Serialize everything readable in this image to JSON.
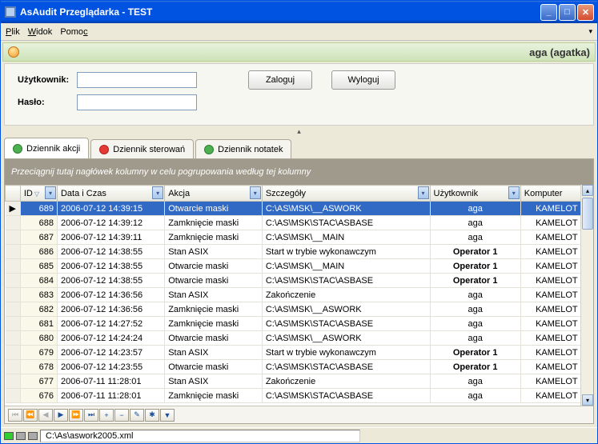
{
  "window": {
    "title": "AsAudit Przeglądarka - TEST"
  },
  "menu": {
    "plik": "Plik",
    "widok": "Widok",
    "pomoc": "Pomoc"
  },
  "userbar": {
    "text": "aga (agatka)"
  },
  "login": {
    "user_label": "Użytkownik:",
    "pass_label": "Hasło:",
    "user_value": "",
    "pass_value": "",
    "login_btn": "Zaloguj",
    "logout_btn": "Wyloguj"
  },
  "tabs": {
    "t0": "Dziennik akcji",
    "t1": "Dziennik sterowań",
    "t2": "Dziennik notatek"
  },
  "group_panel": "Przeciągnij tutaj nagłówek kolumny w celu pogrupowania według tej kolumny",
  "cols": {
    "id": "ID",
    "data": "Data i Czas",
    "akcja": "Akcja",
    "szcz": "Szczegóły",
    "user": "Użytkownik",
    "komp": "Komputer"
  },
  "rows": [
    {
      "id": "689",
      "dt": "2006-07-12 14:39:15",
      "ak": "Otwarcie maski",
      "sz": "C:\\AS\\MSK\\__ASWORK",
      "us": "aga",
      "ko": "KAMELOT",
      "sel": true
    },
    {
      "id": "688",
      "dt": "2006-07-12 14:39:12",
      "ak": "Zamknięcie maski",
      "sz": "C:\\AS\\MSK\\STAC\\ASBASE",
      "us": "aga",
      "ko": "KAMELOT"
    },
    {
      "id": "687",
      "dt": "2006-07-12 14:39:11",
      "ak": "Zamknięcie maski",
      "sz": "C:\\AS\\MSK\\__MAIN",
      "us": "aga",
      "ko": "KAMELOT"
    },
    {
      "id": "686",
      "dt": "2006-07-12 14:38:55",
      "ak": "Stan ASIX",
      "sz": "Start w trybie wykonawczym",
      "us": "Operator 1",
      "ko": "KAMELOT",
      "b": true
    },
    {
      "id": "685",
      "dt": "2006-07-12 14:38:55",
      "ak": "Otwarcie maski",
      "sz": "C:\\AS\\MSK\\__MAIN",
      "us": "Operator 1",
      "ko": "KAMELOT",
      "b": true
    },
    {
      "id": "684",
      "dt": "2006-07-12 14:38:55",
      "ak": "Otwarcie maski",
      "sz": "C:\\AS\\MSK\\STAC\\ASBASE",
      "us": "Operator 1",
      "ko": "KAMELOT",
      "b": true
    },
    {
      "id": "683",
      "dt": "2006-07-12 14:36:56",
      "ak": "Stan ASIX",
      "sz": "Zakończenie",
      "us": "aga",
      "ko": "KAMELOT"
    },
    {
      "id": "682",
      "dt": "2006-07-12 14:36:56",
      "ak": "Zamknięcie maski",
      "sz": "C:\\AS\\MSK\\__ASWORK",
      "us": "aga",
      "ko": "KAMELOT"
    },
    {
      "id": "681",
      "dt": "2006-07-12 14:27:52",
      "ak": "Zamknięcie maski",
      "sz": "C:\\AS\\MSK\\STAC\\ASBASE",
      "us": "aga",
      "ko": "KAMELOT"
    },
    {
      "id": "680",
      "dt": "2006-07-12 14:24:24",
      "ak": "Otwarcie maski",
      "sz": "C:\\AS\\MSK\\__ASWORK",
      "us": "aga",
      "ko": "KAMELOT"
    },
    {
      "id": "679",
      "dt": "2006-07-12 14:23:57",
      "ak": "Stan ASIX",
      "sz": "Start w trybie wykonawczym",
      "us": "Operator 1",
      "ko": "KAMELOT",
      "b": true
    },
    {
      "id": "678",
      "dt": "2006-07-12 14:23:55",
      "ak": "Otwarcie maski",
      "sz": "C:\\AS\\MSK\\STAC\\ASBASE",
      "us": "Operator 1",
      "ko": "KAMELOT",
      "b": true
    },
    {
      "id": "677",
      "dt": "2006-07-11 11:28:01",
      "ak": "Stan ASIX",
      "sz": "Zakończenie",
      "us": "aga",
      "ko": "KAMELOT"
    },
    {
      "id": "676",
      "dt": "2006-07-11 11:28:01",
      "ak": "Zamknięcie maski",
      "sz": "C:\\AS\\MSK\\STAC\\ASBASE",
      "us": "aga",
      "ko": "KAMELOT"
    }
  ],
  "statusbar": {
    "path": "C:\\As\\aswork2005.xml"
  }
}
